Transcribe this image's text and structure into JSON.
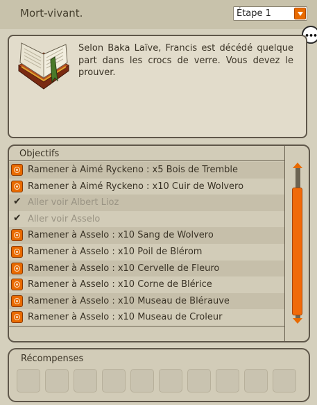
{
  "header": {
    "title": "Mort-vivant.",
    "step_select": {
      "value": "Étape 1"
    }
  },
  "description": "Selon Baka Laïve, Francis est décédé quelque part dans les crocs de verre. Vous devez le prouver.",
  "objectives": {
    "title": "Objectifs",
    "items": [
      {
        "label": "Ramener à Aimé Ryckeno : x5 Bois de Tremble",
        "status": "todo"
      },
      {
        "label": "Ramener à Aimé Ryckeno : x10 Cuir de Wolvero",
        "status": "todo"
      },
      {
        "label": "Aller voir Albert Lioz",
        "status": "done"
      },
      {
        "label": "Aller voir Asselo",
        "status": "done"
      },
      {
        "label": "Ramener à Asselo : x10 Sang de Wolvero",
        "status": "todo"
      },
      {
        "label": "Ramener à Asselo : x10 Poil de Blérom",
        "status": "todo"
      },
      {
        "label": "Ramener à Asselo : x10 Cervelle de Fleuro",
        "status": "todo"
      },
      {
        "label": "Ramener à Asselo : x10 Corne de Blérice",
        "status": "todo"
      },
      {
        "label": "Ramener à Asselo : x10 Museau de Blérauve",
        "status": "todo"
      },
      {
        "label": "Ramener à Asselo : x10 Museau de Croleur",
        "status": "todo"
      }
    ]
  },
  "rewards": {
    "title": "Récompenses",
    "slot_count": 10
  },
  "icons": {
    "step_dropdown": "chevron-down-icon",
    "bubble": "speech-bubble-icon",
    "quest": "quest-book-icon",
    "objective_todo": "target-icon",
    "objective_done": "checkmark-icon"
  },
  "colors": {
    "accent": "#e86a00",
    "background": "#d5d0bd",
    "panel_border": "#5f574a"
  }
}
